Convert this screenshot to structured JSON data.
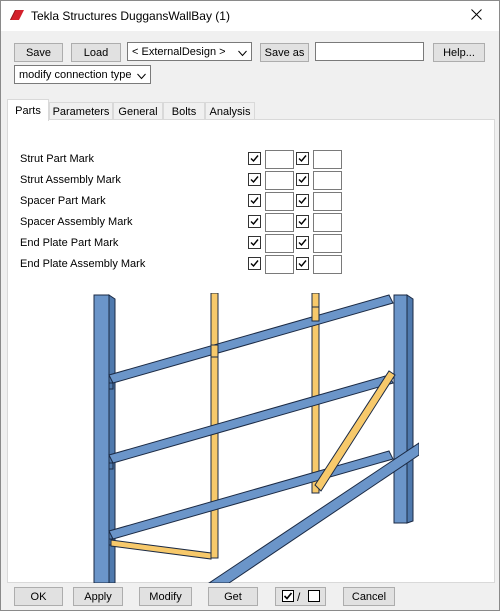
{
  "window": {
    "title": "Tekla Structures  DuggansWallBay (1)",
    "app_icon": "tekla-logo-icon",
    "close_icon": "close-icon"
  },
  "toolbar": {
    "save_label": "Save",
    "load_label": "Load",
    "preset_value": "< ExternalDesign >",
    "save_as_label": "Save as",
    "save_as_value": "",
    "help_label": "Help...",
    "mode_value": "modify connection type"
  },
  "tabs": [
    {
      "label": "Parts",
      "active": true
    },
    {
      "label": "Parameters",
      "active": false
    },
    {
      "label": "General",
      "active": false
    },
    {
      "label": "Bolts",
      "active": false
    },
    {
      "label": "Analysis",
      "active": false
    }
  ],
  "parts": {
    "rows": [
      {
        "label": "Strut Part Mark",
        "check1": true,
        "value1": "",
        "check2": true,
        "value2": ""
      },
      {
        "label": "Strut Assembly Mark",
        "check1": true,
        "value1": "",
        "check2": true,
        "value2": ""
      },
      {
        "label": "Spacer Part Mark",
        "check1": true,
        "value1": "",
        "check2": true,
        "value2": ""
      },
      {
        "label": "Spacer Assembly Mark",
        "check1": true,
        "value1": "",
        "check2": true,
        "value2": ""
      },
      {
        "label": "End Plate Part Mark",
        "check1": true,
        "value1": "",
        "check2": true,
        "value2": ""
      },
      {
        "label": "End Plate Assembly Mark",
        "check1": true,
        "value1": "",
        "check2": true,
        "value2": ""
      }
    ]
  },
  "colors": {
    "column_blue": "#6b95c9",
    "strut_yellow": "#f7c96b",
    "outline": "#1b2a44"
  },
  "bottom": {
    "ok_label": "OK",
    "apply_label": "Apply",
    "modify_label": "Modify",
    "get_label": "Get",
    "toggle_separator": "/",
    "cancel_label": "Cancel"
  }
}
